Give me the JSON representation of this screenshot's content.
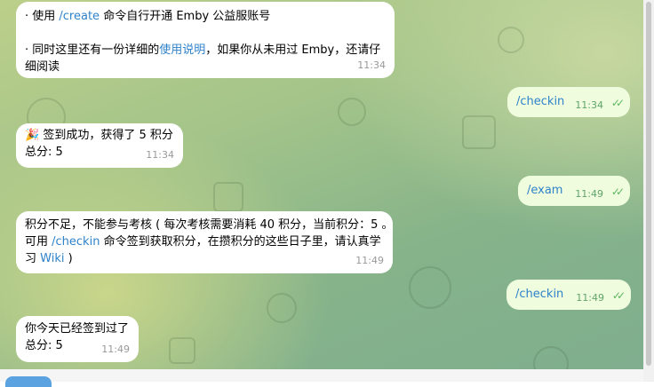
{
  "colors": {
    "link": "#2e82c9",
    "outgoing_bubble": "#effdde",
    "incoming_bubble": "#ffffff",
    "check": "#5fb862"
  },
  "messages": [
    {
      "direction": "in",
      "lines": [
        [
          "· 使用 ",
          "/create",
          " 命令自行开通 Emby 公益服账号"
        ],
        [
          "· 同时这里还有一份详细的",
          "使用说明",
          "，如果你从未用过 Emby，还请仔"
        ],
        [
          "细阅读"
        ]
      ],
      "time": "11:34"
    },
    {
      "direction": "out",
      "text": "/checkin",
      "time": "11:34",
      "status_icon": "double-check-icon"
    },
    {
      "direction": "in",
      "emoji": "🎉",
      "lines": [
        [
          "签到成功，获得了 5 积分"
        ],
        [
          "总分: 5"
        ]
      ],
      "time": "11:34"
    },
    {
      "direction": "out",
      "text": "/exam",
      "time": "11:49",
      "status_icon": "double-check-icon"
    },
    {
      "direction": "in",
      "lines": [
        [
          "积分不足，不能参与考核 ( 每次考核需要消耗 40 积分，当前积分：5 。"
        ],
        [
          "可用 ",
          "/checkin",
          " 命令签到获取积分，在攒积分的这些日子里，请认真学"
        ],
        [
          "习 ",
          "Wiki",
          " )"
        ]
      ],
      "time": "11:49"
    },
    {
      "direction": "out",
      "text": "/checkin",
      "time": "11:49",
      "status_icon": "double-check-icon"
    },
    {
      "direction": "in",
      "lines": [
        [
          "你今天已经签到过了"
        ],
        [
          "总分: 5"
        ]
      ],
      "time": "11:49"
    }
  ]
}
